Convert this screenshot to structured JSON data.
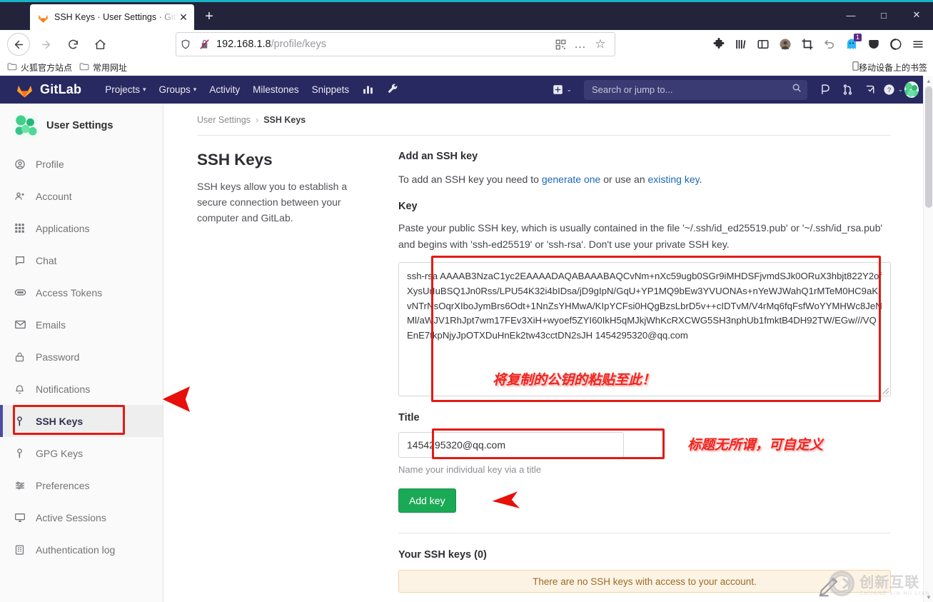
{
  "browser": {
    "tab": {
      "title": "SSH Keys · User Settings · Git",
      "close_label": "✕",
      "favicon": "gitlab-fox-icon"
    },
    "newtab_label": "+",
    "window_controls": {
      "minimize": "—",
      "maximize": "□",
      "close": "✕"
    },
    "nav": {
      "back": "←",
      "forward": "→",
      "reload": "⟳",
      "home": "⌂"
    },
    "url": {
      "host": "192.168.1.8",
      "path": "/profile/keys",
      "full": "192.168.1.8/profile/keys"
    },
    "url_actions": {
      "qr": "qr-code-icon",
      "more": "…",
      "bookmark": "☆"
    },
    "extension_icons": [
      "puzzle-extensions-icon",
      "library-icon",
      "sidebar-icon",
      "account-avatar-icon",
      "screenshot-crop-icon",
      "undo-icon",
      "ghost-privacy-icon",
      "pocket-icon",
      "sync-icon",
      "hamburger-menu-icon"
    ],
    "ghost_badge": "1",
    "bookmarks": [
      {
        "label": "火狐官方站点",
        "icon": "folder-icon"
      },
      {
        "label": "常用网址",
        "icon": "folder-icon"
      }
    ],
    "bookmarks_right": {
      "label": "移动设备上的书签",
      "icon": "mobile-icon"
    }
  },
  "gitlab_nav": {
    "brand": "GitLab",
    "links": [
      {
        "label": "Projects",
        "caret": true
      },
      {
        "label": "Groups",
        "caret": true
      },
      {
        "label": "Activity",
        "caret": false
      },
      {
        "label": "Milestones",
        "caret": false
      },
      {
        "label": "Snippets",
        "caret": false
      }
    ],
    "icon_links": [
      "analytics-chart-icon",
      "wrench-admin-icon"
    ],
    "plus": {
      "icon": "plus-square-icon",
      "caret": "⌄"
    },
    "search_placeholder": "Search or jump to...",
    "right_icons": [
      "issues-icon",
      "merge-requests-icon",
      "todos-icon"
    ],
    "help": {
      "icon": "help-question-icon",
      "caret": "⌄"
    },
    "user": {
      "icon": "user-avatar",
      "caret": "⌄"
    }
  },
  "sidebar": {
    "header": {
      "title": "User Settings",
      "avatar": "user-avatar"
    },
    "items": [
      {
        "label": "Profile",
        "icon": "profile-icon",
        "active": false
      },
      {
        "label": "Account",
        "icon": "account-icon",
        "active": false
      },
      {
        "label": "Applications",
        "icon": "applications-grid-icon",
        "active": false
      },
      {
        "label": "Chat",
        "icon": "chat-bubble-icon",
        "active": false
      },
      {
        "label": "Access Tokens",
        "icon": "token-icon",
        "active": false
      },
      {
        "label": "Emails",
        "icon": "envelope-icon",
        "active": false
      },
      {
        "label": "Password",
        "icon": "lock-icon",
        "active": false
      },
      {
        "label": "Notifications",
        "icon": "bell-icon",
        "active": false
      },
      {
        "label": "SSH Keys",
        "icon": "key-icon",
        "active": true
      },
      {
        "label": "GPG Keys",
        "icon": "key-icon",
        "active": false
      },
      {
        "label": "Preferences",
        "icon": "sliders-icon",
        "active": false
      },
      {
        "label": "Active Sessions",
        "icon": "monitor-icon",
        "active": false
      },
      {
        "label": "Authentication log",
        "icon": "list-log-icon",
        "active": false
      }
    ]
  },
  "content": {
    "breadcrumb": {
      "parent": "User Settings",
      "separator": "›",
      "current": "SSH Keys"
    },
    "left": {
      "heading": "SSH Keys",
      "description": "SSH keys allow you to establish a secure connection between your computer and GitLab."
    },
    "right": {
      "heading": "Add an SSH key",
      "intro_pre": "To add an SSH key you need to ",
      "intro_link1": "generate one",
      "intro_mid": " or use an ",
      "intro_link2": "existing key",
      "intro_post": ".",
      "key_label": "Key",
      "key_help": "Paste your public SSH key, which is usually contained in the file '~/.ssh/id_ed25519.pub' or '~/.ssh/id_rsa.pub' and begins with 'ssh-ed25519' or 'ssh-rsa'. Don't use your private SSH key.",
      "key_value": "ssh-rsa AAAAB3NzaC1yc2EAAAADAQABAAABAQCvNm+nXc59ugb0SGr9iMHDSFjvmdSJk0ORuX3hbjt822Y2ofXysUrIuBSQ1Jn0Rss/LPU54K32i4bIDsa/jD9gIpN/GqU+YP1MQ9bEw3YVUONAs+nYeWJWahQ1rMTeM0HC9aKvNTrNsOqrXIboJymBrs6Odt+1NnZsYHMwA/KIpYCFsi0HQgBzsLbrD5v++cIDTvM/V4rMq6fqFsfWoYYMHWc8JeNMl/aWJV1RhJpt7wm17FEv3XiH+wyoef5ZYI60IkH5qMJkjWhKcRXCWG5SH3nphUb1fmktB4DH92TW/EGw///VQEnE7tkpNjyJpOTXDuHnEk2tw43cctDN2sJH 1454295320@qq.com",
      "title_label": "Title",
      "title_value": "1454295320@qq.com",
      "title_help": "Name your individual key via a title",
      "add_button": "Add key",
      "your_keys_heading": "Your SSH keys (0)",
      "empty_alert": "There are no SSH keys with access to your account."
    }
  },
  "annotations": [
    {
      "name": "paste-key-here-note",
      "text": "将复制的公钥的粘贴至此！"
    },
    {
      "name": "title-is-free-note",
      "text": "标题无所谓，可自定义"
    }
  ],
  "watermark": {
    "letter": "X",
    "main": "创新互联",
    "sub": "CHUANG XIN HU LIAN"
  },
  "colors": {
    "gitlab_nav": "#292961",
    "accent_green": "#1aaa55",
    "annotation_red": "#f0251f",
    "highlight_red": "#e21b15",
    "link_blue": "#1b69b6",
    "alert_bg": "#fdf3e5"
  }
}
